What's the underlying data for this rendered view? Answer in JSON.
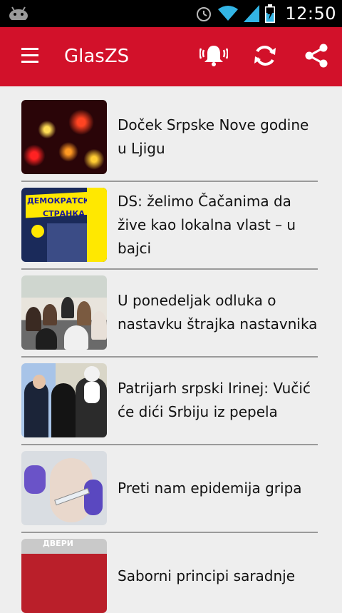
{
  "status_bar": {
    "time": "12:50",
    "icons": [
      "android-icon",
      "alarm-icon",
      "wifi-icon",
      "signal-icon",
      "battery-charging-icon"
    ]
  },
  "toolbar": {
    "title": "GlasZS",
    "icons": [
      "menu-icon",
      "notification-bell-icon",
      "refresh-icon",
      "share-icon"
    ]
  },
  "colors": {
    "toolbar": "#d2112a",
    "background": "#eeeeee",
    "separator": "#9a9a9a"
  },
  "thumbnail_texts": {
    "ds_line1": "ДЕМОКРАТСКА",
    "ds_line2": "СТРАНКА",
    "dveri": "ДВЕРИ"
  },
  "articles": [
    {
      "title": "Doček Srpske Nove godine u Ljigu"
    },
    {
      "title": "DS: želimo Čačanima da žive kao lokalna vlast – u bajci"
    },
    {
      "title": "U ponedeljak odluka o nastavku štrajka nastavnika"
    },
    {
      "title": "Patrijarh srpski Irinej: Vučić će dići Srbiju iz pepela"
    },
    {
      "title": "Preti nam epidemija gripa"
    },
    {
      "title": "Saborni principi saradnje"
    }
  ]
}
